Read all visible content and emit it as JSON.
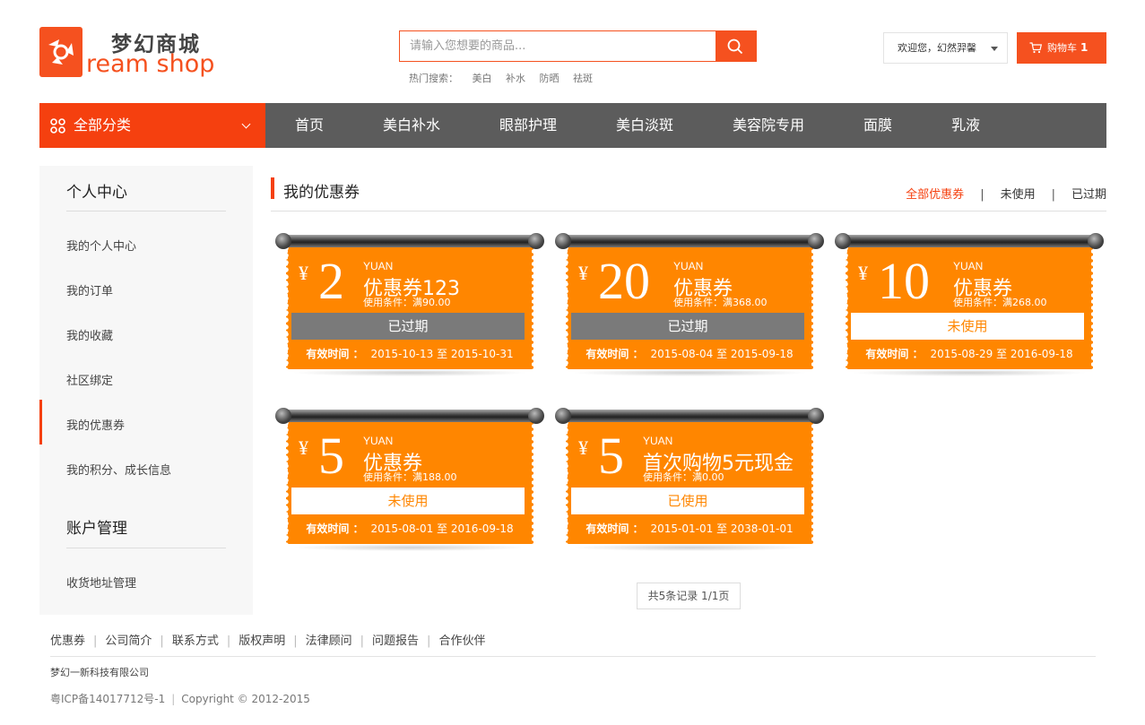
{
  "header": {
    "logo_cn": "梦幻商城",
    "logo_en": "ream shop",
    "search_placeholder": "请输入您想要的商品...",
    "hot_label": "热门搜索：",
    "hot_keywords": [
      "美白",
      "补水",
      "防晒",
      "祛斑"
    ],
    "welcome": "欢迎您，幻然羿馨",
    "cart_label": "购物车",
    "cart_count": "1"
  },
  "nav": {
    "category_label": "全部分类",
    "items": [
      "首页",
      "美白补水",
      "眼部护理",
      "美白淡斑",
      "美容院专用",
      "面膜",
      "乳液"
    ]
  },
  "sidebar": {
    "section1_title": "个人中心",
    "section1_items": [
      "我的个人中心",
      "我的订单",
      "我的收藏",
      "社区绑定",
      "我的优惠券",
      "我的积分、成长信息"
    ],
    "section2_title": "账户管理",
    "section2_items": [
      "收货地址管理"
    ],
    "active_item": "我的优惠券"
  },
  "main": {
    "title": "我的优惠券",
    "filters": [
      "全部优惠券",
      "未使用",
      "已过期"
    ],
    "active_filter": "全部优惠券",
    "currency_symbol": "¥",
    "unit_label": "YUAN",
    "valid_label": "有效时间 ：",
    "coupons": [
      {
        "amount": "2",
        "name": "优惠券123",
        "condition": "使用条件：满90.00",
        "status": "已过期",
        "status_type": "expired",
        "valid": "2015-10-13 至 2015-10-31"
      },
      {
        "amount": "20",
        "name": "优惠券",
        "condition": "使用条件：满368.00",
        "status": "已过期",
        "status_type": "expired",
        "valid": "2015-08-04 至 2015-09-18"
      },
      {
        "amount": "10",
        "name": "优惠券",
        "condition": "使用条件：满268.00",
        "status": "未使用",
        "status_type": "unused",
        "valid": "2015-08-29 至 2016-09-18"
      },
      {
        "amount": "5",
        "name": "优惠券",
        "condition": "使用条件：满188.00",
        "status": "未使用",
        "status_type": "unused",
        "valid": "2015-08-01 至 2016-09-18"
      },
      {
        "amount": "5",
        "name": "首次购物5元现金",
        "condition": "使用条件：满0.00",
        "status": "已使用",
        "status_type": "unused",
        "valid": "2015-01-01 至 2038-01-01"
      }
    ],
    "pager": "共5条记录 1/1页"
  },
  "footer": {
    "links": [
      "优惠券",
      "公司简介",
      "联系方式",
      "版权声明",
      "法律顾问",
      "问题报告",
      "合作伙伴"
    ],
    "company": "梦幻一新科技有限公司",
    "icp": "粤ICP备14017712号-1",
    "copyright": "Copyright © 2012-2015"
  },
  "colors": {
    "accent": "#f5400f",
    "coupon": "#ff8600",
    "nav_bg": "#5c5c5c",
    "expired": "#7a7a7a"
  }
}
